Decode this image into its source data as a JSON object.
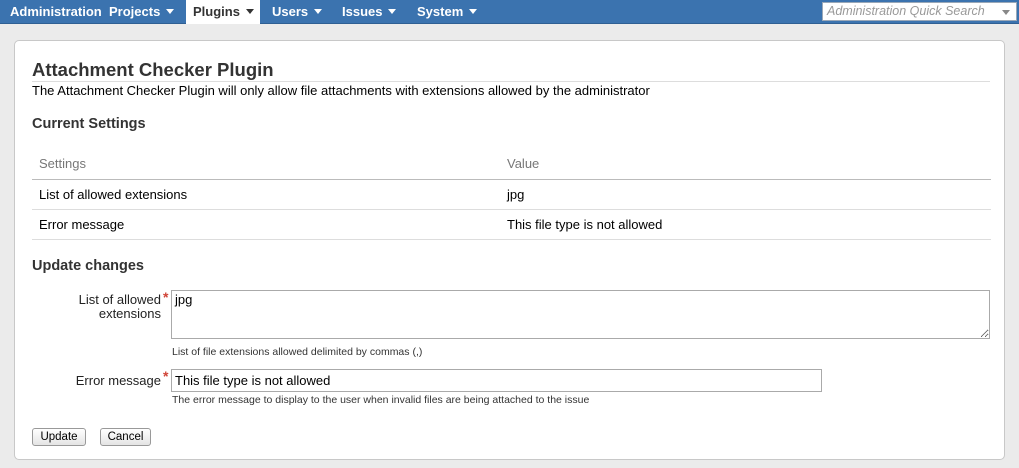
{
  "nav": {
    "administration": "Administration",
    "projects": "Projects",
    "plugins": "Plugins",
    "users": "Users",
    "issues": "Issues",
    "system": "System",
    "quick_search_placeholder": "Administration Quick Search"
  },
  "page": {
    "title": "Attachment Checker Plugin",
    "description": "The Attachment Checker Plugin will only allow file attachments with extensions allowed by the administrator"
  },
  "current_settings": {
    "heading": "Current Settings",
    "columns": [
      "Settings",
      "Value"
    ],
    "rows": [
      {
        "setting": "List of allowed extensions",
        "value": "jpg"
      },
      {
        "setting": "Error message",
        "value": "This file type is not allowed"
      }
    ]
  },
  "update": {
    "heading": "Update changes",
    "extensions_label_line1": "List of allowed",
    "extensions_label_line2": "extensions",
    "extensions_value": "jpg",
    "extensions_hint": "List of file extensions allowed delimited by commas (,)",
    "error_label": "Error message",
    "error_value": "This file type is not allowed",
    "error_hint": "The error message to display to the user when invalid files are being attached to the issue",
    "required_mark": "*",
    "update_button": "Update",
    "cancel_button": "Cancel"
  },
  "colors": {
    "nav_background": "#3b73af",
    "required": "#d04437"
  }
}
